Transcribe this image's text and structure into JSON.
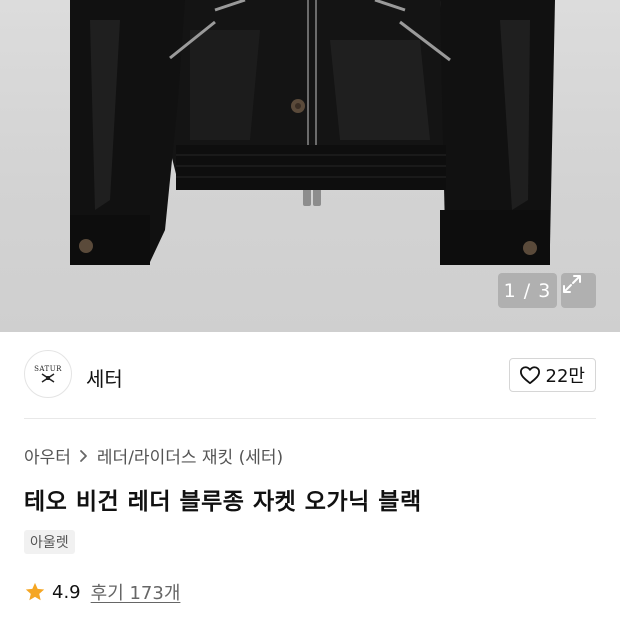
{
  "gallery": {
    "pager_text": "1 / 3",
    "expand_icon": "expand-icon"
  },
  "brand": {
    "logo_text": "SATUR",
    "name": "세터"
  },
  "like": {
    "icon": "heart-outline-icon",
    "count": "22만"
  },
  "breadcrumb": {
    "category": "아우터",
    "separator_icon": "chevron-right-icon",
    "subcategory": "레더/라이더스 재킷 (세터)"
  },
  "product": {
    "title": "테오 비건 레더 블루종 자켓 오가닉 블랙",
    "badge": "아울렛"
  },
  "rating": {
    "icon": "star-icon",
    "score": "4.9",
    "reviews": "후기 173개",
    "star_color": "#f5a623"
  }
}
